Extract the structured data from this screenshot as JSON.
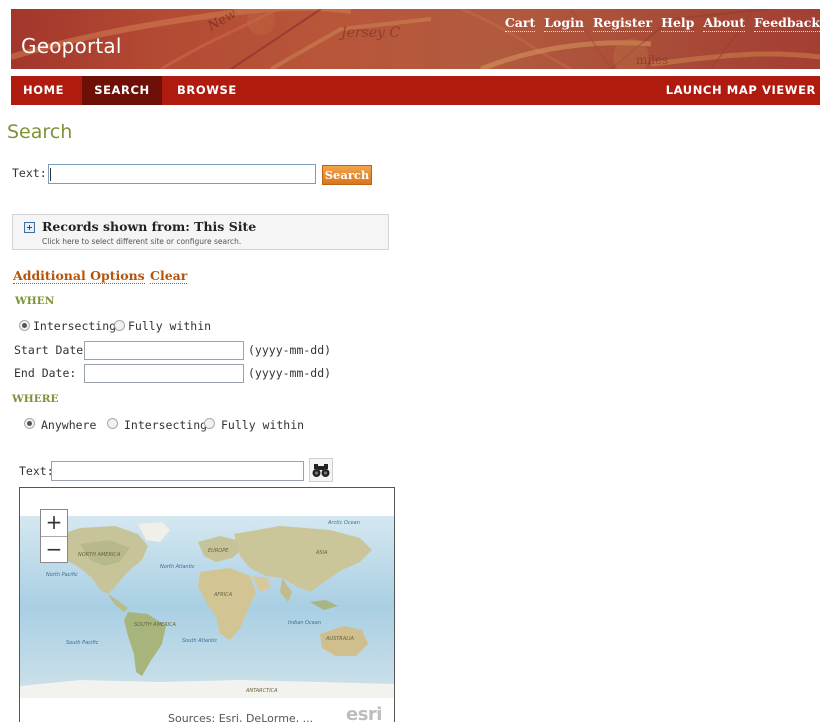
{
  "header": {
    "site_title": "Geoportal",
    "links": [
      {
        "label": "Cart"
      },
      {
        "label": "Login"
      },
      {
        "label": "Register"
      },
      {
        "label": "Help"
      },
      {
        "label": "About"
      },
      {
        "label": "Feedback"
      }
    ],
    "banner_map_texts": [
      "Jersey C",
      "New",
      "miles"
    ]
  },
  "nav": {
    "home": "HOME",
    "search": "SEARCH",
    "browse": "BROWSE",
    "launch_map_viewer": "LAUNCH MAP VIEWER",
    "active_item": "SEARCH"
  },
  "search": {
    "page_title": "Search",
    "text_label": "Text:",
    "text_value": "",
    "search_button": "Search"
  },
  "records": {
    "title": "Records shown from: This Site",
    "hint": "Click here to select different site or configure search."
  },
  "options": {
    "additional_options": "Additional Options",
    "clear": "Clear"
  },
  "when": {
    "heading": "WHEN",
    "radio_intersecting": "Intersecting",
    "radio_fully_within": "Fully within",
    "selected": "Intersecting",
    "start_label": "Start Date:",
    "start_value": "",
    "end_label": "End Date:",
    "end_value": "",
    "date_format": "(yyyy-mm-dd)"
  },
  "where": {
    "heading": "WHERE",
    "radio_anywhere": "Anywhere",
    "radio_intersecting": "Intersecting",
    "radio_fully_within": "Fully within",
    "selected": "Anywhere",
    "text_label": "Text:",
    "text_value": ""
  },
  "map": {
    "zoom_in": "+",
    "zoom_out": "−",
    "attribution": "Sources: Esri, DeLorme, ...",
    "logo": "esri",
    "labels": {
      "arctic_ocean": "Arctic Ocean",
      "north_america": "NORTH AMERICA",
      "north_atlantic": "North Atlantic",
      "north_pacific": "North Pacific",
      "europe": "EUROPE",
      "asia": "ASIA",
      "africa": "AFRICA",
      "south_america": "SOUTH AMERICA",
      "south_atlantic": "South Atlantic",
      "south_pacific": "South Pacific",
      "indian_ocean": "Indian Ocean",
      "australia": "AUSTRALIA",
      "antarctica": "ANTARCTICA"
    }
  },
  "colors": {
    "nav_red": "#b01b10",
    "nav_active": "#6e0f08",
    "accent_green": "#7d9338",
    "link_orange": "#b45309",
    "button_orange": "#e58a2c"
  }
}
